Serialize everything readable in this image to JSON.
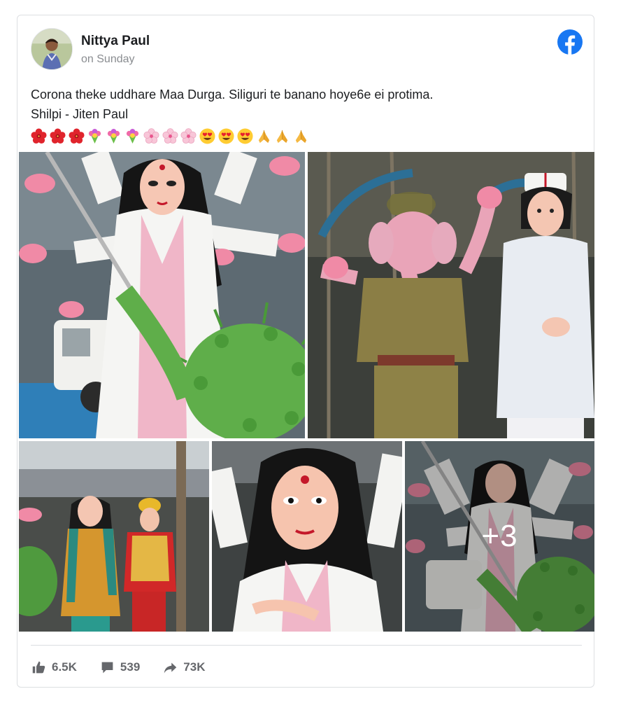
{
  "post": {
    "author": "Nittya Paul",
    "time": "on Sunday",
    "text_line1": "Corona theke uddhare Maa Durga. Siliguri te banano hoye6e ei protima.",
    "text_line2": "Shilpi - Jiten Paul",
    "emojis": [
      "hibiscus",
      "hibiscus",
      "hibiscus",
      "bouquet",
      "bouquet",
      "bouquet",
      "cherry-blossom",
      "cherry-blossom",
      "cherry-blossom",
      "heart-eyes",
      "heart-eyes",
      "heart-eyes",
      "folded-hands",
      "folded-hands",
      "folded-hands"
    ]
  },
  "photos": {
    "items": [
      {
        "name": "photo-durga-doctor-slaying-virus"
      },
      {
        "name": "photo-ganesh-police-and-nurse"
      },
      {
        "name": "photo-idols-in-workshop"
      },
      {
        "name": "photo-durga-face-closeup"
      },
      {
        "name": "photo-durga-more"
      }
    ],
    "more_count": "+3"
  },
  "stats": {
    "likes": "6.5K",
    "comments": "539",
    "shares": "73K"
  },
  "icons": {
    "platform_logo": "facebook-icon",
    "like": "thumbs-up-icon",
    "comment": "comment-icon",
    "share": "share-arrow-icon"
  },
  "colors": {
    "facebook_blue": "#1877f2",
    "stat_gray": "#65676b",
    "border": "#dddfe2"
  }
}
